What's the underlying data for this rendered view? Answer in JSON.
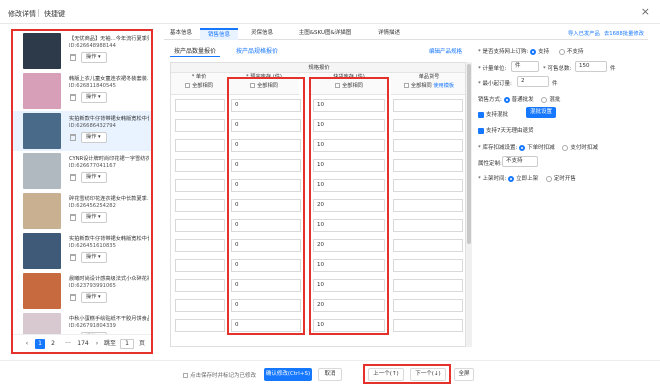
{
  "header": {
    "title": "修改详情",
    "tab2": "快捷键",
    "close": "×"
  },
  "products": [
    {
      "name": "【无忧商品】无袖…今年流行夏季男…",
      "id": "ID:626648988144",
      "op": "操作",
      "color": "#2c3a4a",
      "selected": false
    },
    {
      "name": "韩版上衣儿童女童连衣裙冬装套装…",
      "id": "ID:626811840545",
      "op": "操作",
      "color": "#d7a0b8",
      "selected": false
    },
    {
      "name": "实拍新款牛仔背带裙女韩版宽松中长款…",
      "id": "ID:626686432794",
      "op": "操作",
      "color": "#4a6a8a",
      "selected": true
    },
    {
      "name": "CYNR设计牌时尚印花裙一字雪纺衣…",
      "id": "ID:626677041167",
      "op": "操作",
      "color": "#b0b8c0",
      "selected": false
    },
    {
      "name": "碎花雪纺印花连衣裙女中长款夏季…",
      "id": "ID:626456254282",
      "op": "操作",
      "color": "#c8b090",
      "selected": false
    },
    {
      "name": "实拍新款牛仔背带裙女韩版宽松中长款…",
      "id": "ID:626451610835",
      "op": "操作",
      "color": "#3e5a78",
      "selected": false
    },
    {
      "name": "晨曦时尚设计感高级法式小众碎花裙…",
      "id": "ID:623793991065",
      "op": "操作",
      "color": "#c86a40",
      "selected": false
    },
    {
      "name": "中秋小蛋糕手绘贴纸不干胶月饼食品…",
      "id": "ID:626791804339",
      "op": "操作",
      "color": "#d8c8d0",
      "selected": false
    }
  ],
  "pager": {
    "prev": "‹",
    "page1": "1",
    "page2": "2",
    "ellipsis": "···",
    "last": "174",
    "next": "›",
    "goto_label": "跳至",
    "goto_value": "1",
    "page_suffix": "页"
  },
  "tabs": [
    "基本信息",
    "销售信息",
    "灵保信息",
    "主图&SKU图&详描图",
    "详情描述"
  ],
  "top_links": [
    "导入已发产品",
    "去1688批量修改"
  ],
  "subtabs": [
    "按产品数量报价",
    "按产品规格报价"
  ],
  "edit_spec_link": "编辑产品规格",
  "spec_header": "规格报价",
  "columns": {
    "price": {
      "title": "* 单价",
      "batch": "全部相同"
    },
    "presale": {
      "title": "* 预完库存 (件)",
      "batch": "全部相同"
    },
    "stock": {
      "title": "快货库存 (件)",
      "batch": "全部相同"
    },
    "sku": {
      "title": "单品货号",
      "batch": "全部相同",
      "use_spec": "使用模板"
    }
  },
  "rows": [
    {
      "presale": "0",
      "stock": "10"
    },
    {
      "presale": "0",
      "stock": "10"
    },
    {
      "presale": "0",
      "stock": "10"
    },
    {
      "presale": "0",
      "stock": "10"
    },
    {
      "presale": "0",
      "stock": "10"
    },
    {
      "presale": "0",
      "stock": "20"
    },
    {
      "presale": "0",
      "stock": "10"
    },
    {
      "presale": "0",
      "stock": "20"
    },
    {
      "presale": "0",
      "stock": "10"
    },
    {
      "presale": "0",
      "stock": "10"
    },
    {
      "presale": "0",
      "stock": "20"
    },
    {
      "presale": "0",
      "stock": "10"
    }
  ],
  "right": {
    "cod_label": "* 是否支持网上订购:",
    "cod_yes": "支持",
    "cod_no": "不支持",
    "unit_label": "* 计量单位:",
    "unit_value": "件",
    "sellable_label": "* 可售总数:",
    "sellable_value": "150",
    "sellable_unit": "件",
    "minorder_label": "* 最小起订量:",
    "minorder_value": "2",
    "minorder_unit": "件",
    "sale_mode_label": "销售方式:",
    "sale_mode_value": "普通批发",
    "sale_mode_other": "混批",
    "mix_label": "支持混批",
    "mix_btn": "混批设置",
    "returns_label": "支持7天无理由退货",
    "inventory_label": "* 库存扣减设置:",
    "inventory_opt1": "下单时扣减",
    "inventory_opt2": "支付时扣减",
    "attr_label": "属性定制:",
    "attr_value": "不支持",
    "launch_label": "* 上架时间:",
    "launch_opt1": "立即上架",
    "launch_opt2": "定时开售"
  },
  "footer": {
    "save_check": "点击保存时并标记为已修改",
    "confirm": "确认修改(Ctrl+S)",
    "cancel": "取消",
    "prev": "上一个(↑)",
    "next": "下一个(↓)",
    "fullscreen": "全屏"
  },
  "colors": {
    "accent": "#1677ff",
    "highlight": "#e5312c"
  }
}
